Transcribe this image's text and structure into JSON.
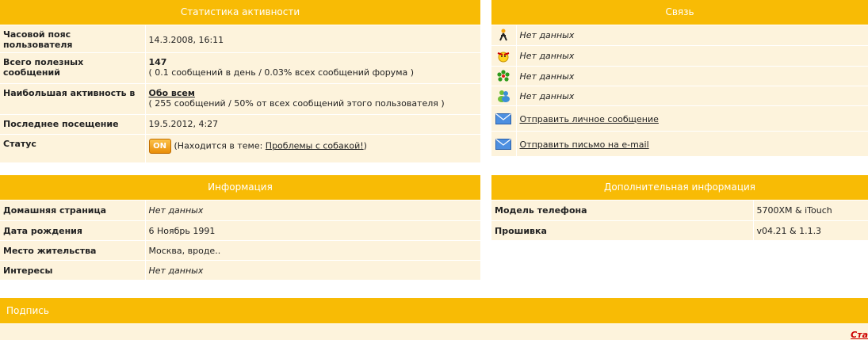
{
  "activity": {
    "title": "Статистика активности",
    "rows": {
      "timezone": {
        "label": "Часовой пояс пользователя",
        "value": "14.3.2008, 16:11"
      },
      "posts": {
        "label": "Всего полезных сообщений",
        "value": "147",
        "detail": "( 0.1 сообщений в день / 0.03% всех сообщений форума )"
      },
      "most_active": {
        "label": "Наибольшая активность в",
        "value": "Обо всем",
        "detail": "( 255 сообщений / 50% от всех сообщений этого пользователя )"
      },
      "last_visit": {
        "label": "Последнее посещение",
        "value": "19.5.2012, 4:27"
      },
      "status": {
        "label": "Статус",
        "badge": "ON",
        "prefix": "(Находится в теме: ",
        "topic": "Проблемы с собакой!",
        "suffix": ")"
      }
    }
  },
  "contact": {
    "title": "Связь",
    "rows": [
      {
        "icon": "aim-icon",
        "value": "Нет данных"
      },
      {
        "icon": "yahoo-icon",
        "value": "Нет данных"
      },
      {
        "icon": "icq-icon",
        "value": "Нет данных"
      },
      {
        "icon": "msn-icon",
        "value": "Нет данных"
      },
      {
        "icon": "envelope-icon",
        "value": "Отправить личное сообщение"
      },
      {
        "icon": "envelope-icon",
        "value": "Отправить письмо на e-mail"
      }
    ]
  },
  "info": {
    "title": "Информация",
    "rows": [
      {
        "label": "Домашняя страница",
        "value": "Нет данных"
      },
      {
        "label": "Дата рождения",
        "value": "6 Ноябрь 1991"
      },
      {
        "label": "Место жительства",
        "value": "Москва, вроде.."
      },
      {
        "label": "Интересы",
        "value": "Нет данных"
      }
    ]
  },
  "extra": {
    "title": "Дополнительная информация",
    "rows": [
      {
        "label": "Модель телефона",
        "value": "5700XM & iTouch"
      },
      {
        "label": "Прошивка",
        "value": "v04.21 & 1.1.3"
      }
    ]
  },
  "signature": {
    "title": "Подпись",
    "corner_text": "Ста"
  },
  "colors": {
    "header": "#f8bb05",
    "row": "#fdf3dc",
    "link_red": "#cc0000"
  }
}
